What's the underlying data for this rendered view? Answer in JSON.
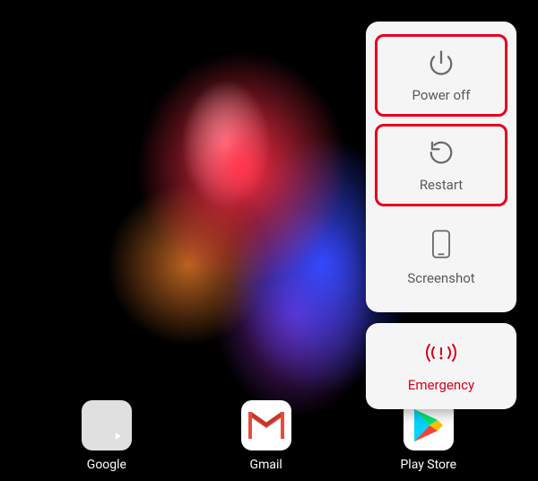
{
  "dock": {
    "apps": [
      {
        "label": "Google",
        "icon": "google-folder"
      },
      {
        "label": "Gmail",
        "icon": "gmail"
      },
      {
        "label": "Play Store",
        "icon": "play-store"
      }
    ]
  },
  "power_menu": {
    "items": [
      {
        "label": "Power off",
        "icon": "power-icon",
        "highlighted": true
      },
      {
        "label": "Restart",
        "icon": "restart-icon",
        "highlighted": true
      },
      {
        "label": "Screenshot",
        "icon": "screenshot-icon",
        "highlighted": false
      }
    ],
    "emergency": {
      "label": "Emergency",
      "icon": "emergency-icon"
    }
  },
  "colors": {
    "highlight": "#e6001f",
    "emergency": "#d8001a",
    "panel_bg": "#f5f5f5",
    "icon_gray": "#6a6a6a"
  }
}
